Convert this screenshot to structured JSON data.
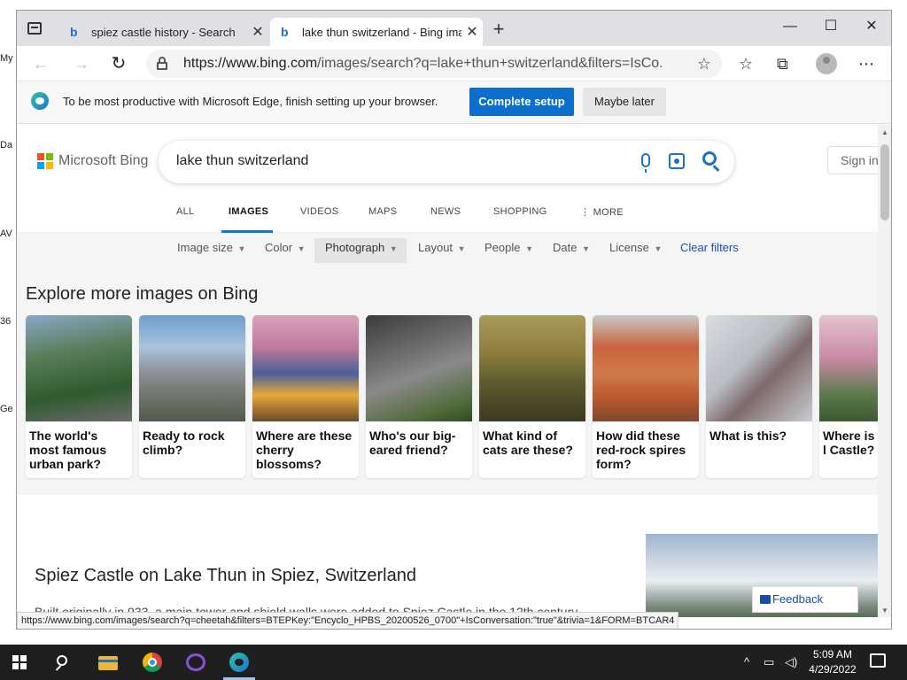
{
  "desktop": {
    "icon_labels": [
      "My",
      "Da",
      "AV",
      "36",
      "Ge"
    ]
  },
  "browser": {
    "tabs": [
      {
        "title": "spiez castle history - Search",
        "favicon": "bing-icon"
      },
      {
        "title": "lake thun switzerland - Bing images",
        "favicon": "bing-icon"
      }
    ],
    "url_host": "https://www.bing.com",
    "url_path": "/images/search?q=lake+thun+switzerland&filters=IsCo...",
    "status_url": "https://www.bing.com/images/search?q=cheetah&filters=BTEPKey:\"Encyclo_HPBS_20200526_0700\"+IsConversation:\"true\"&trivia=1&FORM=BTCAR4"
  },
  "infobar": {
    "message": "To be most productive with Microsoft Edge, finish setting up your browser.",
    "complete_label": "Complete setup",
    "later_label": "Maybe later"
  },
  "bing": {
    "brand": "Microsoft Bing",
    "query": "lake thun switzerland",
    "sign_in": "Sign in",
    "scopes": [
      "ALL",
      "IMAGES",
      "VIDEOS",
      "MAPS",
      "NEWS",
      "SHOPPING",
      "MORE"
    ],
    "active_scope": "IMAGES",
    "filters": [
      "Image size",
      "Color",
      "Photograph",
      "Layout",
      "People",
      "Date",
      "License"
    ],
    "selected_filter": "Photograph",
    "clear_filters": "Clear filters",
    "explore_title": "Explore more images on Bing",
    "cards": [
      {
        "caption": "The world's most famous urban park?"
      },
      {
        "caption": "Ready to rock climb?"
      },
      {
        "caption": "Where are these cherry blossoms?"
      },
      {
        "caption": "Who's our big-eared friend?"
      },
      {
        "caption": "What kind of cats are these?"
      },
      {
        "caption": "How did these red-rock spires form?"
      },
      {
        "caption": "What is this?"
      },
      {
        "caption": "Where is l Castle?"
      }
    ],
    "result_title": "Spiez Castle on Lake Thun in Spiez, Switzerland",
    "result_snippet": "Built originally in 933, a main tower and shield walls were added to Spiez Castle in the 12th century.",
    "feedback": "Feedback"
  },
  "taskbar": {
    "time": "5:09 AM",
    "date": "4/29/2022"
  }
}
